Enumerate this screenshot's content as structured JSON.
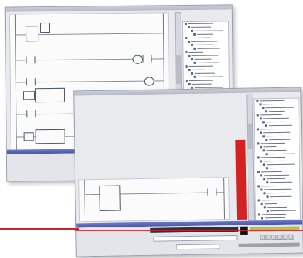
{
  "back_window": {
    "title": "",
    "tree_rows": 32
  },
  "front_window": {
    "title": "",
    "tree_rows": 34
  },
  "colors": {
    "accent_red": "#d22222",
    "rule_red": "#c4272b",
    "status_blue": "#4953a8",
    "energized_green": "#2c9a58",
    "olive": "#b8bc4a"
  },
  "icons": [
    "contact-icon",
    "coil-icon",
    "function-block-icon",
    "tree-node-icon",
    "toolbar-button-icon"
  ]
}
